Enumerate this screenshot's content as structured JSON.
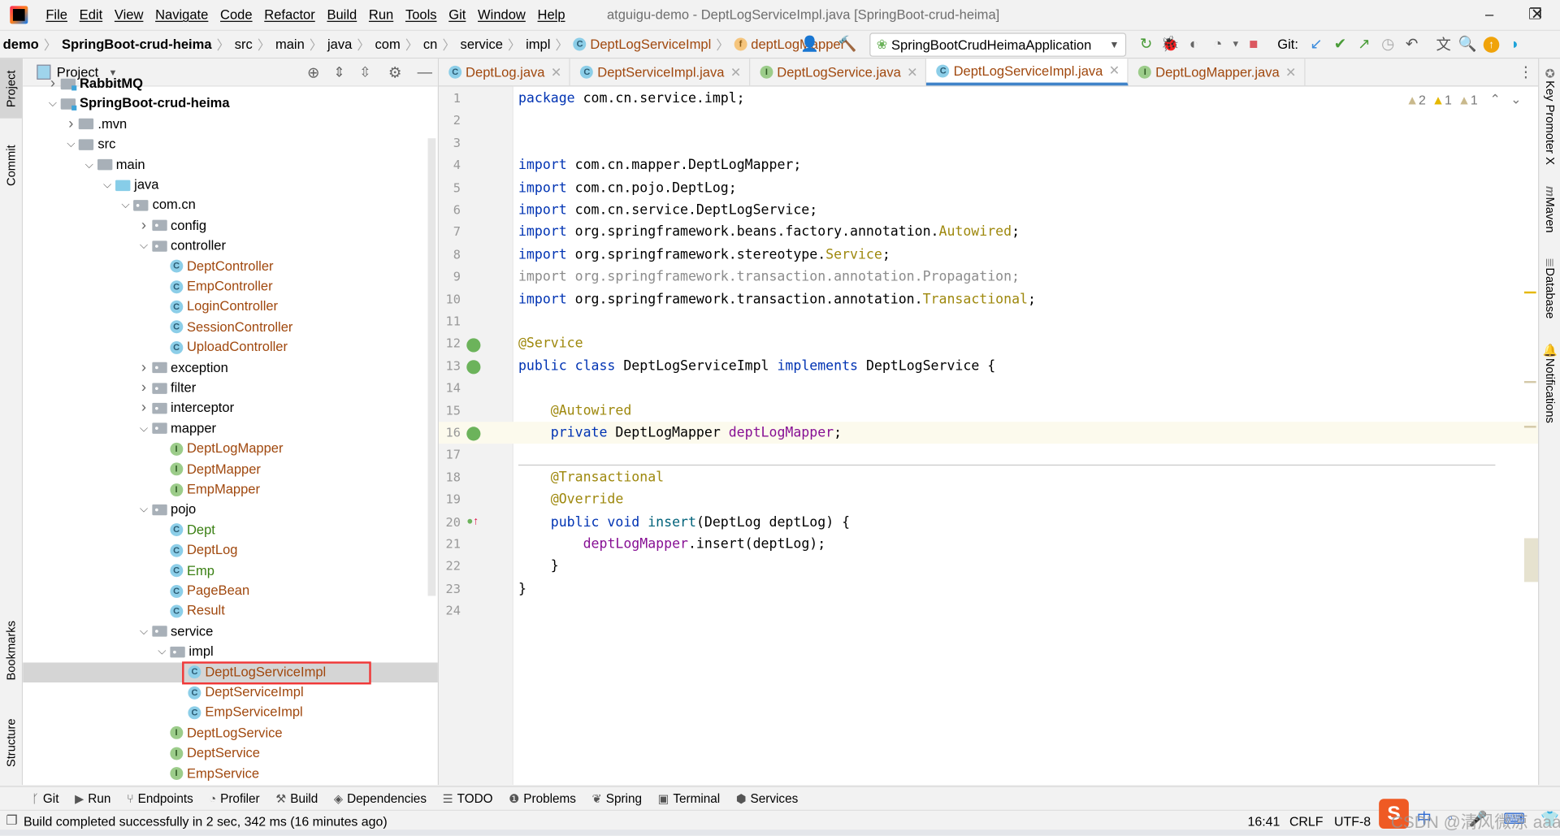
{
  "window": {
    "title": "atguigu-demo - DeptLogServiceImpl.java [SpringBoot-crud-heima]",
    "menu": [
      "File",
      "Edit",
      "View",
      "Navigate",
      "Code",
      "Refactor",
      "Build",
      "Run",
      "Tools",
      "Git",
      "Window",
      "Help"
    ],
    "controls": {
      "minimize": "–",
      "maximize": "❐",
      "close": "✕"
    }
  },
  "breadcrumb": [
    {
      "label": "demo",
      "bold": true
    },
    {
      "label": "SpringBoot-crud-heima",
      "bold": true
    },
    {
      "label": "src"
    },
    {
      "label": "main"
    },
    {
      "label": "java"
    },
    {
      "label": "com"
    },
    {
      "label": "cn"
    },
    {
      "label": "service"
    },
    {
      "label": "impl"
    },
    {
      "label": "DeptLogServiceImpl",
      "badge": "C"
    },
    {
      "label": "deptLogMapper",
      "badge": "f"
    }
  ],
  "toolbar": {
    "run_config": "SpringBootCrudHeimaApplication",
    "git_label": "Git:"
  },
  "left_strip": [
    "Project",
    "Commit",
    "Bookmarks",
    "Structure"
  ],
  "right_strip": [
    "Key Promoter X",
    "Maven",
    "Database",
    "Notifications"
  ],
  "project": {
    "title": "Project",
    "tree": [
      {
        "label": "RabbitMQ",
        "level": 0,
        "type": "module",
        "expanded": false,
        "bold": true
      },
      {
        "label": "SpringBoot-crud-heima",
        "level": 0,
        "type": "module",
        "expanded": true,
        "bold": true
      },
      {
        "label": ".mvn",
        "level": 1,
        "type": "folder",
        "expanded": false
      },
      {
        "label": "src",
        "level": 1,
        "type": "folder",
        "expanded": true
      },
      {
        "label": "main",
        "level": 2,
        "type": "folder",
        "expanded": true
      },
      {
        "label": "java",
        "level": 3,
        "type": "src",
        "expanded": true
      },
      {
        "label": "com.cn",
        "level": 4,
        "type": "pkg",
        "expanded": true
      },
      {
        "label": "config",
        "level": 5,
        "type": "pkg",
        "expanded": false
      },
      {
        "label": "controller",
        "level": 5,
        "type": "pkg",
        "expanded": true
      },
      {
        "label": "DeptController",
        "level": 6,
        "type": "C",
        "color": "brown"
      },
      {
        "label": "EmpController",
        "level": 6,
        "type": "C",
        "color": "brown"
      },
      {
        "label": "LoginController",
        "level": 6,
        "type": "C",
        "color": "brown"
      },
      {
        "label": "SessionController",
        "level": 6,
        "type": "C",
        "color": "brown"
      },
      {
        "label": "UploadController",
        "level": 6,
        "type": "C",
        "color": "brown"
      },
      {
        "label": "exception",
        "level": 5,
        "type": "pkg",
        "expanded": false
      },
      {
        "label": "filter",
        "level": 5,
        "type": "pkg",
        "expanded": false
      },
      {
        "label": "interceptor",
        "level": 5,
        "type": "pkg",
        "expanded": false
      },
      {
        "label": "mapper",
        "level": 5,
        "type": "pkg",
        "expanded": true
      },
      {
        "label": "DeptLogMapper",
        "level": 6,
        "type": "I",
        "color": "brown"
      },
      {
        "label": "DeptMapper",
        "level": 6,
        "type": "I",
        "color": "brown"
      },
      {
        "label": "EmpMapper",
        "level": 6,
        "type": "I",
        "color": "brown"
      },
      {
        "label": "pojo",
        "level": 5,
        "type": "pkg",
        "expanded": true
      },
      {
        "label": "Dept",
        "level": 6,
        "type": "C",
        "color": "green"
      },
      {
        "label": "DeptLog",
        "level": 6,
        "type": "C",
        "color": "brown"
      },
      {
        "label": "Emp",
        "level": 6,
        "type": "C",
        "color": "green"
      },
      {
        "label": "PageBean",
        "level": 6,
        "type": "C",
        "color": "brown"
      },
      {
        "label": "Result",
        "level": 6,
        "type": "C",
        "color": "brown"
      },
      {
        "label": "service",
        "level": 5,
        "type": "pkg",
        "expanded": true
      },
      {
        "label": "impl",
        "level": 6,
        "type": "pkg",
        "expanded": true
      },
      {
        "label": "DeptLogServiceImpl",
        "level": 7,
        "type": "C",
        "color": "brown",
        "selected": true,
        "highlighted": true
      },
      {
        "label": "DeptServiceImpl",
        "level": 7,
        "type": "C",
        "color": "brown"
      },
      {
        "label": "EmpServiceImpl",
        "level": 7,
        "type": "C",
        "color": "brown"
      },
      {
        "label": "DeptLogService",
        "level": 6,
        "type": "I",
        "color": "brown"
      },
      {
        "label": "DeptService",
        "level": 6,
        "type": "I",
        "color": "brown"
      },
      {
        "label": "EmpService",
        "level": 6,
        "type": "I",
        "color": "brown"
      }
    ]
  },
  "tabs": [
    {
      "label": "DeptLog.java",
      "badge": "C"
    },
    {
      "label": "DeptServiceImpl.java",
      "badge": "C"
    },
    {
      "label": "DeptLogService.java",
      "badge": "I"
    },
    {
      "label": "DeptLogServiceImpl.java",
      "badge": "C",
      "active": true
    },
    {
      "label": "DeptLogMapper.java",
      "badge": "I"
    }
  ],
  "inspections": {
    "weak_warnings": "2",
    "warnings": "1",
    "typos": "1"
  },
  "editor": {
    "current_line": 16,
    "lines": [
      [
        [
          "package",
          "k"
        ],
        [
          " com.cn.service.impl;",
          "t"
        ]
      ],
      [],
      [],
      [
        [
          "import",
          "k"
        ],
        [
          " com.cn.mapper.DeptLogMapper;",
          "t"
        ]
      ],
      [
        [
          "import",
          "k"
        ],
        [
          " com.cn.pojo.DeptLog;",
          "t"
        ]
      ],
      [
        [
          "import",
          "k"
        ],
        [
          " com.cn.service.DeptLogService;",
          "t"
        ]
      ],
      [
        [
          "import",
          "k"
        ],
        [
          " org.springframework.beans.factory.annotation.",
          "t"
        ],
        [
          "Autowired",
          "a"
        ],
        [
          ";",
          "t"
        ]
      ],
      [
        [
          "import",
          "k"
        ],
        [
          " org.springframework.stereotype.",
          "t"
        ],
        [
          "Service",
          "a"
        ],
        [
          ";",
          "t"
        ]
      ],
      [
        [
          "import org.springframework.transaction.annotation.Propagation;",
          "g"
        ]
      ],
      [
        [
          "import",
          "k"
        ],
        [
          " org.springframework.transaction.annotation.",
          "t"
        ],
        [
          "Transactional",
          "a"
        ],
        [
          ";",
          "t"
        ]
      ],
      [],
      [
        [
          "@Service",
          "a"
        ]
      ],
      [
        [
          "public class",
          "k"
        ],
        [
          " DeptLogServiceImpl ",
          "t"
        ],
        [
          "implements",
          "k"
        ],
        [
          " DeptLogService {",
          "t"
        ]
      ],
      [],
      [
        [
          "    @Autowired",
          "a"
        ]
      ],
      [
        [
          "    private",
          "k"
        ],
        [
          " DeptLogMapper ",
          "t"
        ],
        [
          "deptLogMapper",
          "fld"
        ],
        [
          ";",
          "t"
        ]
      ],
      [],
      [
        [
          "    @Transactional",
          "a"
        ]
      ],
      [
        [
          "    @Override",
          "a"
        ]
      ],
      [
        [
          "    public void",
          "k"
        ],
        [
          " ",
          "t"
        ],
        [
          "insert",
          "m"
        ],
        [
          "(DeptLog deptLog) {",
          "t"
        ]
      ],
      [
        [
          "        ",
          "t"
        ],
        [
          "deptLogMapper",
          "fld"
        ],
        [
          ".insert(deptLog);",
          "t"
        ]
      ],
      [
        [
          "    }",
          "t"
        ]
      ],
      [
        [
          "}",
          "t"
        ]
      ],
      []
    ]
  },
  "tool_windows": [
    {
      "label": "Git",
      "icon": "git-icon"
    },
    {
      "label": "Run",
      "icon": "run-icon"
    },
    {
      "label": "Endpoints",
      "icon": "endpoints-icon"
    },
    {
      "label": "Profiler",
      "icon": "profiler-icon"
    },
    {
      "label": "Build",
      "icon": "build-icon"
    },
    {
      "label": "Dependencies",
      "icon": "dependencies-icon"
    },
    {
      "label": "TODO",
      "icon": "todo-icon"
    },
    {
      "label": "Problems",
      "icon": "problems-icon"
    },
    {
      "label": "Spring",
      "icon": "spring-icon"
    },
    {
      "label": "Terminal",
      "icon": "terminal-icon"
    },
    {
      "label": "Services",
      "icon": "services-icon"
    }
  ],
  "status": {
    "message": "Build completed successfully in 2 sec, 342 ms (16 minutes ago)",
    "position": "16:41",
    "line_separator": "CRLF",
    "encoding": "UTF-8",
    "indent": "4"
  },
  "ime": {
    "mode": "中"
  },
  "watermark": "CSDN @清风微凉 aaa",
  "colors": {
    "accent": "#4083c9",
    "keyword": "#0033b3",
    "annotation": "#9e880d",
    "field": "#871094",
    "vcs_modified": "#a0480e",
    "vcs_green": "#397f12",
    "highlight_box": "#f03838"
  }
}
